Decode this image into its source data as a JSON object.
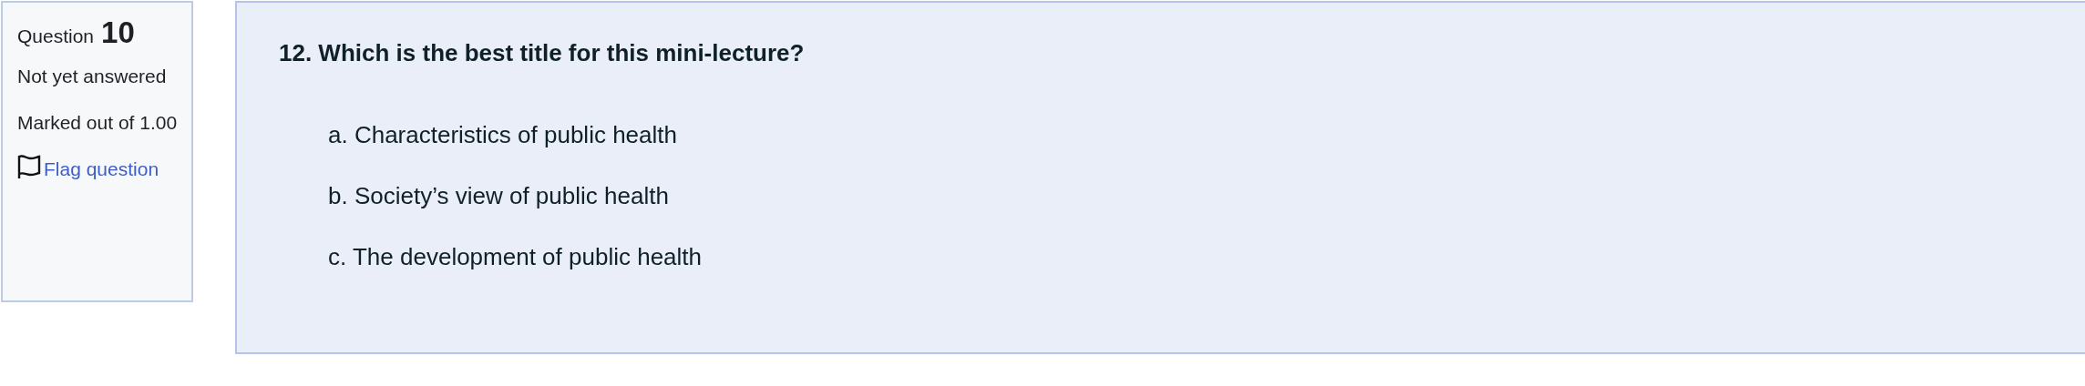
{
  "info": {
    "label": "Question",
    "number": "10",
    "state": "Not yet answered",
    "marks": "Marked out of 1.00",
    "flag_link": "Flag question"
  },
  "question": {
    "text": "12. Which is the best title for this mini-lecture?",
    "options": [
      {
        "letter": "a.",
        "text": "Characteristics of public health"
      },
      {
        "letter": "b.",
        "text": "Society’s view of public health"
      },
      {
        "letter": "c.",
        "text": "The development of public health"
      }
    ]
  }
}
